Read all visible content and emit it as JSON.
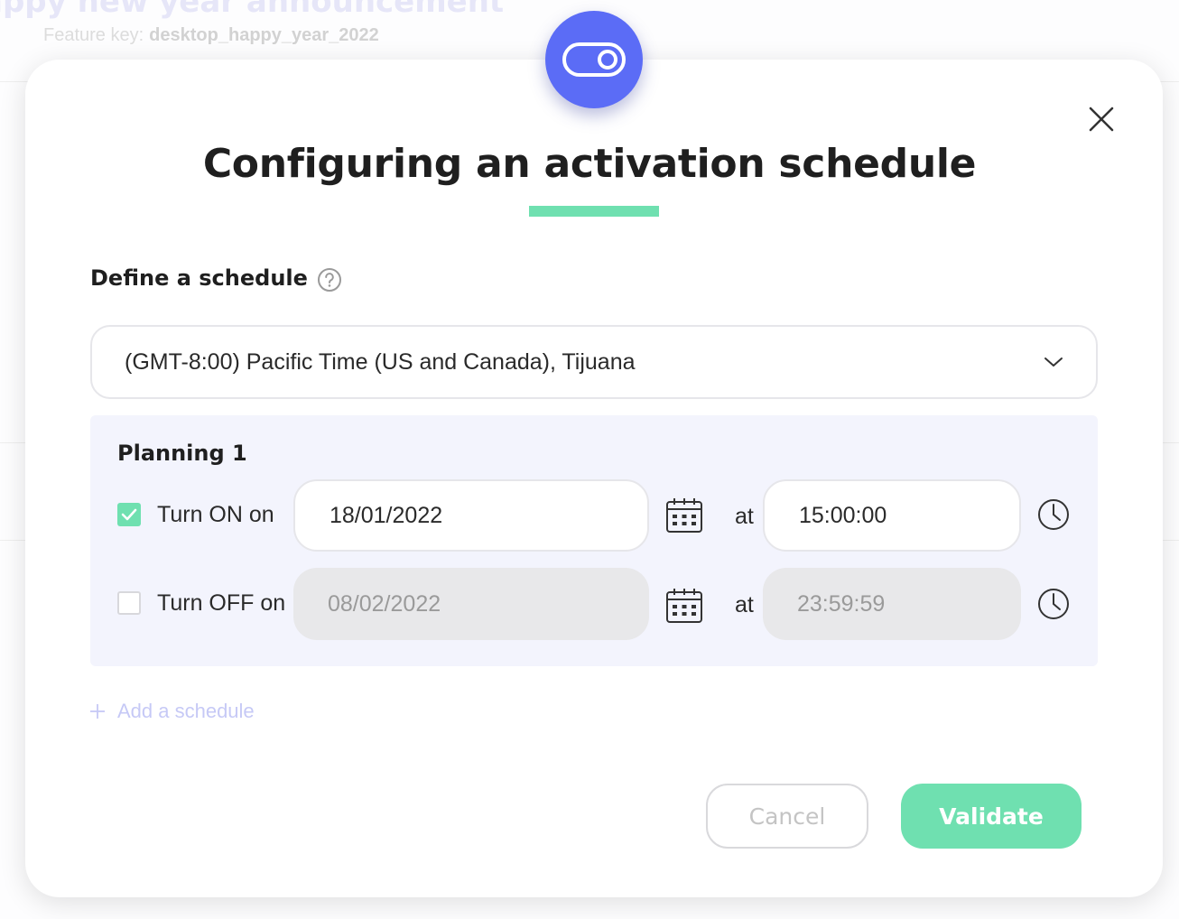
{
  "background": {
    "title": "appy new year announcement",
    "feature_key_label": "Feature key:",
    "feature_key_value": "desktop_happy_year_2022"
  },
  "modal": {
    "badge_icon": "toggle-icon",
    "title": "Configuring an activation schedule",
    "close_icon": "close-icon",
    "section_label": "Define a schedule",
    "help_icon": "question-circle-icon",
    "timezone": {
      "value": "(GMT-8:00) Pacific Time (US and Canada), Tijuana",
      "icon": "chevron-down-icon"
    },
    "planning": {
      "title": "Planning 1",
      "turn_on": {
        "checked": true,
        "label": "Turn ON on",
        "date": "18/01/2022",
        "at_label": "at",
        "time": "15:00:00"
      },
      "turn_off": {
        "checked": false,
        "label": "Turn OFF on",
        "date": "08/02/2022",
        "at_label": "at",
        "time": "23:59:59"
      }
    },
    "add_schedule": "Add a schedule",
    "buttons": {
      "cancel": "Cancel",
      "validate": "Validate"
    }
  },
  "colors": {
    "accent": "#5b6cf6",
    "success": "#6fe0b0",
    "panel": "#f3f4fd"
  }
}
